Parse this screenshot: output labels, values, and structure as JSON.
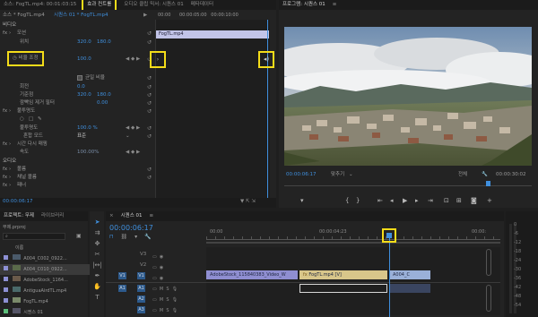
{
  "source_tabs": {
    "source": "소스: FogTL.mp4: 00:01:03:15",
    "effect_controls": "효과 컨트롤",
    "audio_mixer": "오디오 클립 믹서: 시퀀스 01",
    "metadata": "메타데이터"
  },
  "effect_controls": {
    "master_clip": "소스 * FogTL.mp4",
    "sequence_clip": "시퀀스 01 * FogTL.mp4",
    "timecode_start": "00:00",
    "clip_name": "FogTL.mp4",
    "video_header": "비디오",
    "motion": "모션",
    "position_label": "위치",
    "position_x": "320.0",
    "position_y": "180.0",
    "scale_label": "비율 조정",
    "scale_value": "100.0",
    "uniform_scale": "균일 비율",
    "rotation_label": "회전",
    "rotation_value": "0.0",
    "anchor_label": "기준점",
    "anchor_x": "320.0",
    "anchor_y": "180.0",
    "flicker_label": "깜빡임 제거 필터",
    "flicker_value": "0.00",
    "opacity": "불투명도",
    "opacity_label": "불투명도",
    "opacity_value": "100.0 %",
    "blend_label": "혼합 모드",
    "blend_value": "표준",
    "time_remap": "시간 다시 매핑",
    "speed_label": "속도",
    "speed_value": "100.00%",
    "audio_header": "오디오",
    "volume": "볼륨",
    "channel_volume": "채널 볼륨",
    "panner": "패너",
    "bottom_timecode": "00:00:06:17"
  },
  "program": {
    "title": "프로그램: 시퀀스 01",
    "timecode": "00:00:06:17",
    "fit": "맞추기",
    "quality": "전체",
    "duration": "00:00:30:02"
  },
  "project": {
    "tab_project": "프로젝트: 무제",
    "tab_library": "라이브러리",
    "file": "무제.prproj",
    "name_header": "이름",
    "items": [
      "A004_C002_0922...",
      "A004_C010_0922...",
      "AdobeStock_1164...",
      "AntiguaAirdTL.mp4",
      "FogTL.mp4",
      "시퀀스 01"
    ]
  },
  "timeline": {
    "tab": "시퀀스 01",
    "timecode": "00:00:06:17",
    "ruler": [
      "00:00",
      "00:00:04:23",
      "00:00:"
    ],
    "tracks_video": [
      "V3",
      "V2",
      "V1"
    ],
    "tracks_audio": [
      "A1",
      "A2",
      "A3"
    ],
    "src_v": "V1",
    "src_a": "A1",
    "clips": {
      "stock": "AdobeStock_115840383_Video_W",
      "fog": "FogTL.mp4 [V]",
      "a004": "A004_C"
    }
  },
  "meter": [
    "0",
    "-6",
    "-12",
    "-18",
    "-24",
    "-30",
    "-36",
    "-42",
    "-48",
    "-54"
  ],
  "colors": {
    "accent": "#3f8fdd",
    "highlight": "#f4dc19",
    "clip_violet": "#8f8ed1",
    "clip_yellow": "#d8c68a",
    "clip_blue": "#9ab0d8"
  }
}
